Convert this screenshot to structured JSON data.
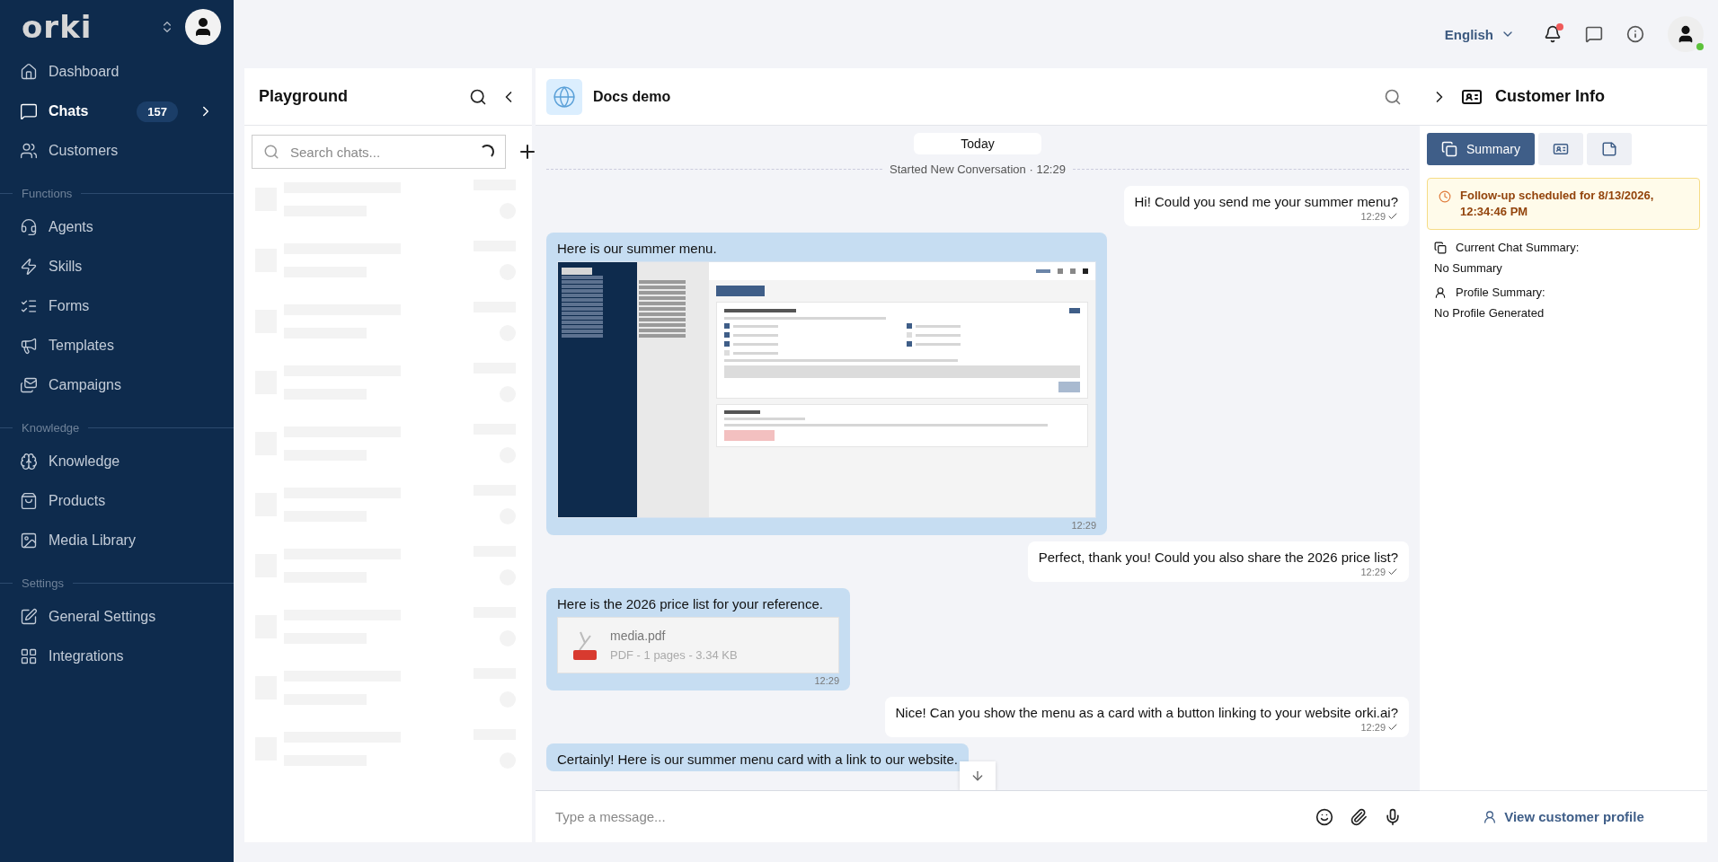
{
  "sidebar": {
    "logo": "orki",
    "sections": [
      {
        "items": [
          {
            "label": "Dashboard",
            "selected": false
          },
          {
            "label": "Chats",
            "selected": true,
            "badge": "157"
          },
          {
            "label": "Customers",
            "selected": false
          }
        ]
      },
      {
        "heading": "Functions",
        "items": [
          {
            "label": "Agents",
            "selected": false
          },
          {
            "label": "Skills",
            "selected": false
          },
          {
            "label": "Forms",
            "selected": false
          },
          {
            "label": "Templates",
            "selected": false
          },
          {
            "label": "Campaigns",
            "selected": false
          }
        ]
      },
      {
        "heading": "Knowledge",
        "items": [
          {
            "label": "Knowledge",
            "selected": false
          },
          {
            "label": "Products",
            "selected": false
          },
          {
            "label": "Media Library",
            "selected": false
          }
        ]
      },
      {
        "heading": "Settings",
        "items": [
          {
            "label": "General Settings",
            "selected": false
          },
          {
            "label": "Integrations",
            "selected": false
          }
        ]
      }
    ]
  },
  "topbar": {
    "language": "English",
    "unread_notifications": true,
    "online": true
  },
  "playground": {
    "title": "Playground",
    "search": {
      "placeholder": "Search chats..."
    },
    "loading": true
  },
  "chat": {
    "title": "Docs demo",
    "date": "Today",
    "event": "Started New Conversation",
    "event_separator": "·",
    "event_time": "12:29",
    "messages": [
      {
        "kind": "text",
        "outgoing": true,
        "text": "Hi! Could you send me your summer menu?",
        "time": "12:29",
        "read": true
      },
      {
        "kind": "image",
        "outgoing": false,
        "text": "Here is our summer menu.",
        "time": "12:29"
      },
      {
        "kind": "text",
        "outgoing": true,
        "text": "Perfect, thank you! Could you also share the 2026 price list?",
        "time": "12:29",
        "read": true
      },
      {
        "kind": "file",
        "outgoing": false,
        "text": "Here is the 2026 price list for your reference.",
        "time": "12:29",
        "file": {
          "name": "media.pdf",
          "meta": "PDF - 1 pages - 3.34 KB"
        }
      },
      {
        "kind": "text",
        "outgoing": true,
        "text": "Nice! Can you show the menu as a card with a button linking to your website orki.ai?",
        "time": "12:29",
        "read": true
      },
      {
        "kind": "text",
        "outgoing": false,
        "text": "Certainly! Here is our summer menu card with a link to our website."
      }
    ],
    "composer": {
      "placeholder": "Type a message..."
    }
  },
  "customer_info": {
    "title": "Customer Info",
    "tabs": [
      {
        "label": "Summary",
        "selected": true
      },
      {
        "selected": false
      },
      {
        "selected": false
      }
    ],
    "follow_up": "Follow-up scheduled for 8/13/2026, 12:34:46 PM",
    "sections": [
      {
        "title": "Current Chat Summary:",
        "value": "No Summary"
      },
      {
        "title": "Profile Summary:",
        "value": "No Profile Generated"
      }
    ],
    "profile_link": "View customer profile"
  }
}
